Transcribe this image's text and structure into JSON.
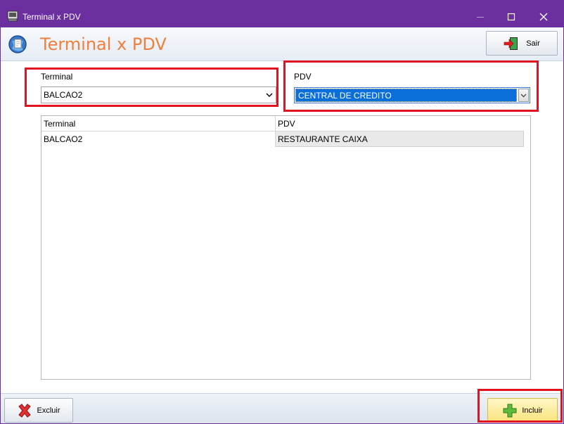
{
  "window": {
    "title": "Terminal x PDV",
    "accent": "#6b2fa0",
    "controls": {
      "minimize_icon": "minimize-icon",
      "maximize_icon": "maximize-icon",
      "close_icon": "close-icon"
    }
  },
  "header": {
    "title": "Terminal x PDV",
    "title_color": "#f07f3c",
    "exit_label": "Sair"
  },
  "form": {
    "terminal_label": "Terminal",
    "terminal_value": "BALCAO2",
    "pdv_label": "PDV",
    "pdv_value": "CENTRAL DE CREDITO"
  },
  "grid": {
    "columns": [
      "Terminal",
      "PDV"
    ],
    "rows": [
      [
        "BALCAO2",
        "RESTAURANTE CAIXA"
      ]
    ]
  },
  "footer": {
    "delete_label": "Excluir",
    "add_label": "Incluir"
  }
}
